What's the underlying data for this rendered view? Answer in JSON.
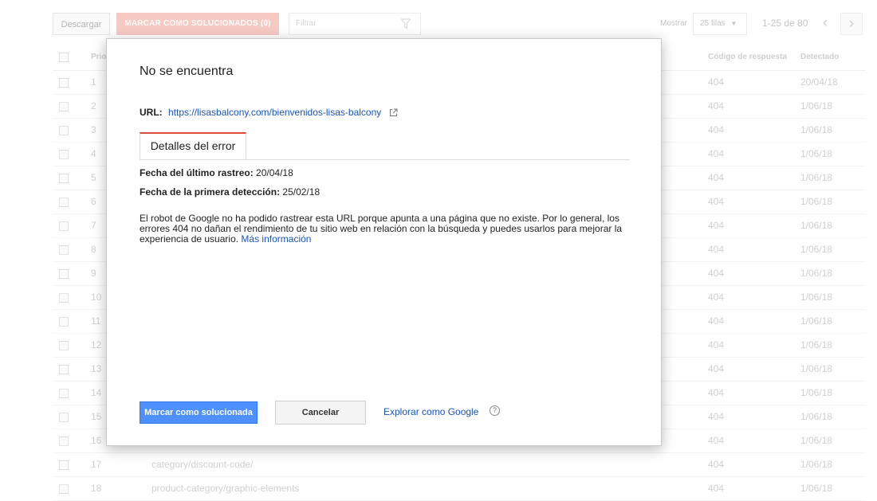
{
  "toolbar": {
    "download_label": "Descargar",
    "mark_fixed_label": "MARCAR COMO SOLUCIONADOS (0)",
    "filter_placeholder": "Filtrar",
    "show_label": "Mostrar",
    "rows_select_value": "25 filas",
    "pagination_text": "1-25 de 80"
  },
  "table": {
    "columns": {
      "priority": "Prio",
      "response_code": "Código de respuesta",
      "detected": "Detectado"
    },
    "rows": [
      {
        "num": "1",
        "url": "",
        "code": "404",
        "date": "20/04/18"
      },
      {
        "num": "2",
        "url": "",
        "code": "404",
        "date": "1/06/18"
      },
      {
        "num": "3",
        "url": "",
        "code": "404",
        "date": "1/06/18"
      },
      {
        "num": "4",
        "url": "",
        "code": "404",
        "date": "1/06/18"
      },
      {
        "num": "5",
        "url": "",
        "code": "404",
        "date": "1/06/18"
      },
      {
        "num": "6",
        "url": "",
        "code": "404",
        "date": "1/06/18"
      },
      {
        "num": "7",
        "url": "",
        "code": "404",
        "date": "1/06/18"
      },
      {
        "num": "8",
        "url": "",
        "code": "404",
        "date": "1/06/18"
      },
      {
        "num": "9",
        "url": "",
        "code": "404",
        "date": "1/06/18"
      },
      {
        "num": "10",
        "url": "",
        "code": "404",
        "date": "1/06/18"
      },
      {
        "num": "11",
        "url": "",
        "code": "404",
        "date": "1/06/18"
      },
      {
        "num": "12",
        "url": "",
        "code": "404",
        "date": "1/06/18"
      },
      {
        "num": "13",
        "url": "",
        "code": "404",
        "date": "1/06/18"
      },
      {
        "num": "14",
        "url": "",
        "code": "404",
        "date": "1/06/18"
      },
      {
        "num": "15",
        "url": "",
        "code": "404",
        "date": "1/06/18"
      },
      {
        "num": "16",
        "url": "",
        "code": "404",
        "date": "1/06/18"
      },
      {
        "num": "17",
        "url": "category/discount-code/",
        "code": "404",
        "date": "1/06/18"
      },
      {
        "num": "18",
        "url": "product-category/graphic-elements",
        "code": "404",
        "date": "1/06/18"
      }
    ]
  },
  "dialog": {
    "title": "No se encuentra",
    "url_label": "URL:",
    "url_value": "https://lisasbalcony.com/bienvenidos-lisas-balcony",
    "tab_label": "Detalles del error",
    "last_crawl_label": "Fecha del último rastreo:",
    "last_crawl_value": "20/04/18",
    "first_detected_label": "Fecha de la primera detección:",
    "first_detected_value": "25/02/18",
    "description": "El robot de Google no ha podido rastrear esta URL porque apunta a una página que no existe. Por lo general, los errores 404 no dañan el rendimiento de tu sitio web en relación con la búsqueda y puedes usarlos para mejorar la experiencia de usuario.",
    "more_info_link": "Más información",
    "mark_fixed_button": "Marcar como solucionada",
    "cancel_button": "Cancelar",
    "fetch_as_google_link": "Explorar como Google",
    "help_icon": "?"
  },
  "colors": {
    "primary_button": "#4d90fe",
    "link": "#1a54b8",
    "tab_accent": "#dd4b39",
    "mark_fixed_bg": "#f6c9c3"
  }
}
